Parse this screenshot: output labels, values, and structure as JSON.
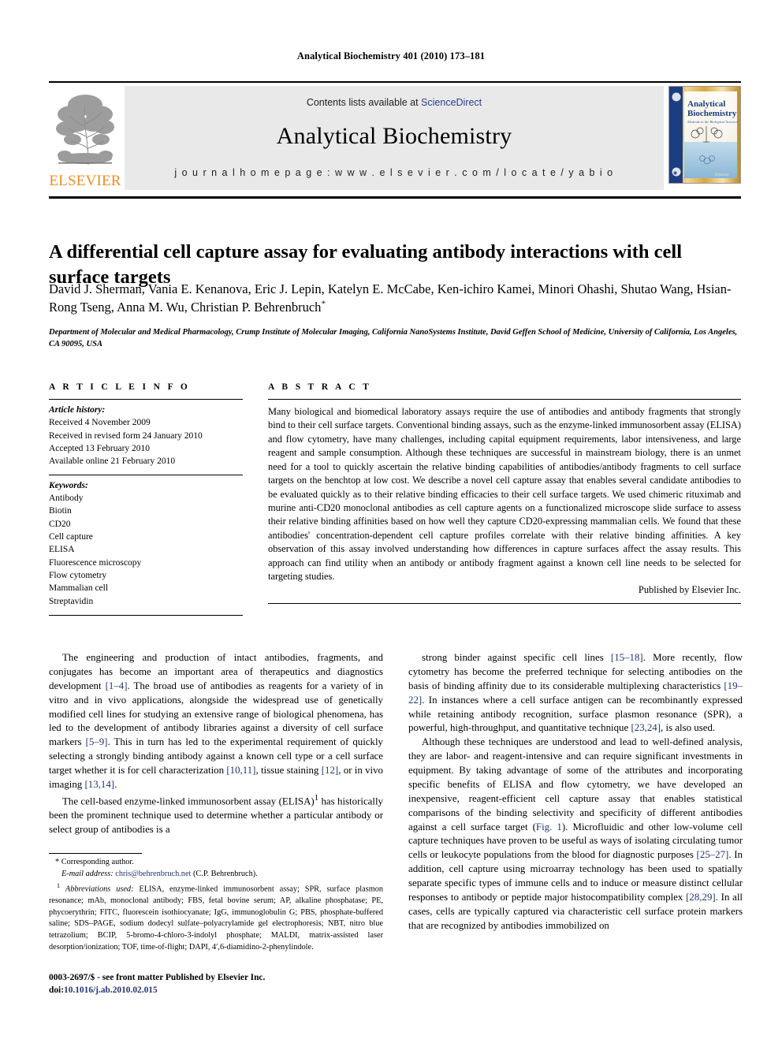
{
  "running_head": "Analytical Biochemistry 401 (2010) 173–181",
  "masthead": {
    "publisher_wordmark": "ELSEVIER",
    "contents_prefix": "Contents lists available at ",
    "contents_link": "ScienceDirect",
    "journal_name": "Analytical Biochemistry",
    "homepage_label": "j o u r n a l   h o m e p a g e :   w w w . e l s e v i e r . c o m / l o c a t e / y a b i o",
    "cover": {
      "line1": "Analytical",
      "line2": "Biochemistry",
      "tagline": "Methods in the Biological Sciences"
    },
    "link_color": "#2b3f8c",
    "elsevier_orange": "#ec8d22",
    "band_color": "#e9e9e9"
  },
  "article": {
    "title": "A differential cell capture assay for evaluating antibody interactions with cell surface targets",
    "authors": "David J. Sherman, Vania E. Kenanova, Eric J. Lepin, Katelyn E. McCabe, Ken-ichiro Kamei, Minori Ohashi, Shutao Wang, Hsian-Rong Tseng, Anna M. Wu, Christian P. Behrenbruch",
    "corresponding_marker": "*",
    "affiliation": "Department of Molecular and Medical Pharmacology, Crump Institute of Molecular Imaging, California NanoSystems Institute, David Geffen School of Medicine, University of California, Los Angeles, CA 90095, USA"
  },
  "article_info": {
    "heading": "A R T I C L E   I N F O",
    "history_label": "Article history:",
    "history": [
      "Received 4 November 2009",
      "Received in revised form 24 January 2010",
      "Accepted 13 February 2010",
      "Available online 21 February 2010"
    ],
    "keywords_label": "Keywords:",
    "keywords": [
      "Antibody",
      "Biotin",
      "CD20",
      "Cell capture",
      "ELISA",
      "Fluorescence microscopy",
      "Flow cytometry",
      "Mammalian cell",
      "Streptavidin"
    ]
  },
  "abstract": {
    "heading": "A B S T R A C T",
    "text": "Many biological and biomedical laboratory assays require the use of antibodies and antibody fragments that strongly bind to their cell surface targets. Conventional binding assays, such as the enzyme-linked immunosorbent assay (ELISA) and flow cytometry, have many challenges, including capital equipment requirements, labor intensiveness, and large reagent and sample consumption. Although these techniques are successful in mainstream biology, there is an unmet need for a tool to quickly ascertain the relative binding capabilities of antibodies/antibody fragments to cell surface targets on the benchtop at low cost. We describe a novel cell capture assay that enables several candidate antibodies to be evaluated quickly as to their relative binding efficacies to their cell surface targets. We used chimeric rituximab and murine anti-CD20 monoclonal antibodies as cell capture agents on a functionalized microscope slide surface to assess their relative binding affinities based on how well they capture CD20-expressing mammalian cells. We found that these antibodies' concentration-dependent cell capture profiles correlate with their relative binding affinities. A key observation of this assay involved understanding how differences in capture surfaces affect the assay results. This approach can find utility when an antibody or antibody fragment against a known cell line needs to be selected for targeting studies.",
    "publisher_line": "Published by Elsevier Inc."
  },
  "body": {
    "left_paragraphs": [
      {
        "segments": [
          {
            "t": "The engineering and production of intact antibodies, fragments, and conjugates has become an important area of therapeutics and diagnostics development ",
            "k": "text"
          },
          {
            "t": "[1–4]",
            "k": "ref"
          },
          {
            "t": ". The broad use of antibodies as reagents for a variety of in vitro and in vivo applications, alongside the widespread use of genetically modified cell lines for studying an extensive range of biological phenomena, has led to the development of antibody libraries against a diversity of cell surface markers ",
            "k": "text"
          },
          {
            "t": "[5–9]",
            "k": "ref"
          },
          {
            "t": ". This in turn has led to the experimental requirement of quickly selecting a strongly binding antibody against a known cell type or a cell surface target whether it is for cell characterization ",
            "k": "text"
          },
          {
            "t": "[10,11]",
            "k": "ref"
          },
          {
            "t": ", tissue staining ",
            "k": "text"
          },
          {
            "t": "[12]",
            "k": "ref"
          },
          {
            "t": ", or in vivo imaging ",
            "k": "text"
          },
          {
            "t": "[13,14]",
            "k": "ref"
          },
          {
            "t": ".",
            "k": "text"
          }
        ]
      },
      {
        "segments": [
          {
            "t": "The cell-based enzyme-linked immunosorbent assay (ELISA)",
            "k": "text"
          },
          {
            "t": "1",
            "k": "sup"
          },
          {
            "t": " has historically been the prominent technique used to determine whether a particular antibody or select group of antibodies is a",
            "k": "text"
          }
        ]
      }
    ],
    "right_paragraphs": [
      {
        "segments": [
          {
            "t": "strong binder against specific cell lines ",
            "k": "text"
          },
          {
            "t": "[15–18]",
            "k": "ref"
          },
          {
            "t": ". More recently, flow cytometry has become the preferred technique for selecting antibodies on the basis of binding affinity due to its considerable multiplexing characteristics ",
            "k": "text"
          },
          {
            "t": "[19–22]",
            "k": "ref"
          },
          {
            "t": ". In instances where a cell surface antigen can be recombinantly expressed while retaining antibody recognition, surface plasmon resonance (SPR), a powerful, high-throughput, and quantitative technique ",
            "k": "text"
          },
          {
            "t": "[23,24]",
            "k": "ref"
          },
          {
            "t": ", is also used.",
            "k": "text"
          }
        ]
      },
      {
        "segments": [
          {
            "t": "Although these techniques are understood and lead to well-defined analysis, they are labor- and reagent-intensive and can require significant investments in equipment. By taking advantage of some of the attributes and incorporating specific benefits of ELISA and flow cytometry, we have developed an inexpensive, reagent-efficient cell capture assay that enables statistical comparisons of the binding selectivity and specificity of different antibodies against a cell surface target (",
            "k": "text"
          },
          {
            "t": "Fig. 1",
            "k": "ref"
          },
          {
            "t": "). Microfluidic and other low-volume cell capture techniques have proven to be useful as ways of isolating circulating tumor cells or leukocyte populations from the blood for diagnostic purposes ",
            "k": "text"
          },
          {
            "t": "[25–27]",
            "k": "ref"
          },
          {
            "t": ". In addition, cell capture using microarray technology has been used to spatially separate specific types of immune cells and to induce or measure distinct cellular responses to antibody or peptide major histocompatibility complex ",
            "k": "text"
          },
          {
            "t": "[28,29]",
            "k": "ref"
          },
          {
            "t": ". In all cases, cells are typically captured via characteristic cell surface protein markers that are recognized by antibodies immobilized on",
            "k": "text"
          }
        ]
      }
    ]
  },
  "footnotes": {
    "corresponding_marker": "*",
    "corresponding_text": "Corresponding author.",
    "email_label": "E-mail address:",
    "email": "chris@behrenbruch.net",
    "email_owner": "(C.P. Behrenbruch).",
    "abbrev_marker": "1",
    "abbrev_label": "Abbreviations used:",
    "abbrev_text": "ELISA, enzyme-linked immunosorbent assay; SPR, surface plasmon resonance; mAb, monoclonal antibody; FBS, fetal bovine serum; AP, alkaline phosphatase; PE, phycoerythrin; FITC, fluorescein isothiocyanate; IgG, immunoglobulin G; PBS, phosphate-buffered saline; SDS–PAGE, sodium dodecyl sulfate–polyacrylamide gel electrophoresis; NBT, nitro blue tetrazolium; BCIP, 5-bromo-4-chloro-3-indolyl phosphate; MALDI, matrix-assisted laser desorption/ionization; TOF, time-of-flight; DAPI, 4′,6-diamidino-2-phenylindole."
  },
  "imprint": {
    "line1": "0003-2697/$ - see front matter Published by Elsevier Inc.",
    "doi_label": "doi:",
    "doi_value": "10.1016/j.ab.2010.02.015"
  }
}
